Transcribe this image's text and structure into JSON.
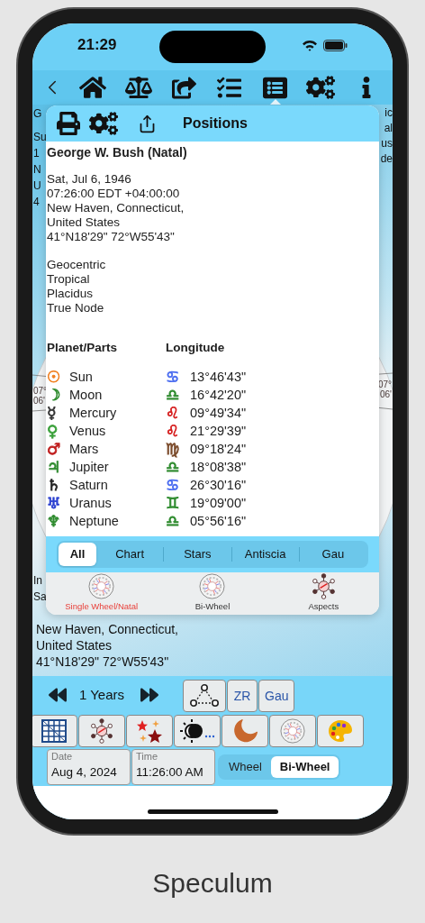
{
  "status_bar": {
    "time": "21:29"
  },
  "toolbar": {
    "tools": [
      {
        "kind": "home",
        "selected": false
      },
      {
        "kind": "scales",
        "selected": false
      },
      {
        "kind": "share",
        "selected": false
      },
      {
        "kind": "checklist",
        "selected": false
      },
      {
        "kind": "list",
        "selected": true
      },
      {
        "kind": "gears",
        "selected": false
      },
      {
        "kind": "info",
        "selected": false
      }
    ]
  },
  "background": {
    "left_fragments": [
      "G",
      "Su",
      "1",
      "N",
      "U",
      "4"
    ],
    "right_fragments": [
      "ic",
      "al",
      "us",
      "de"
    ],
    "wheel_labels": [
      {
        "degree": "07°",
        "minute": "06'"
      },
      {
        "degree": "07°",
        "minute": "06'"
      }
    ],
    "cut_lines": [
      "In",
      "Sa"
    ],
    "lines": [
      "New Haven, Connecticut,",
      "United States",
      "41°N18'29\" 72°W55'43\""
    ]
  },
  "popup": {
    "title": "Positions",
    "chart_name": "George W. Bush (Natal)",
    "details": [
      "Sat, Jul 6, 1946",
      "07:26:00 EDT +04:00:00",
      "New Haven, Connecticut,",
      "United States",
      "41°N18'29\" 72°W55'43\""
    ],
    "settings": [
      "Geocentric",
      "Tropical",
      "Placidus",
      "True Node"
    ],
    "columns": [
      "Planet/Parts",
      "Longitude"
    ],
    "rows": [
      {
        "symbol": "☉",
        "color": "#f07f1f",
        "name": "Sun",
        "sign": {
          "symbol": "♋",
          "color": "#4a6cf0"
        },
        "longitude": "13°46'43\""
      },
      {
        "symbol": "☽",
        "color": "#2e8b2e",
        "name": "Moon",
        "sign": {
          "symbol": "♎",
          "color": "#2e8b2e"
        },
        "longitude": "16°42'20\""
      },
      {
        "symbol": "☿",
        "color": "#333333",
        "name": "Mercury",
        "sign": {
          "symbol": "♌",
          "color": "#d62020"
        },
        "longitude": "09°49'34\""
      },
      {
        "symbol": "♀",
        "color": "#3aa03a",
        "name": "Venus",
        "sign": {
          "symbol": "♌",
          "color": "#d62020"
        },
        "longitude": "21°29'39\""
      },
      {
        "symbol": "♂",
        "color": "#c02020",
        "name": "Mars",
        "sign": {
          "symbol": "♍",
          "color": "#7a4a2a"
        },
        "longitude": "09°18'24\""
      },
      {
        "symbol": "♃",
        "color": "#2e8b2e",
        "name": "Jupiter",
        "sign": {
          "symbol": "♎",
          "color": "#2e8b2e"
        },
        "longitude": "18°08'38\""
      },
      {
        "symbol": "♄",
        "color": "#222222",
        "name": "Saturn",
        "sign": {
          "symbol": "♋",
          "color": "#4a6cf0"
        },
        "longitude": "26°30'16\""
      },
      {
        "symbol": "♅",
        "color": "#2a3fd0",
        "name": "Uranus",
        "sign": {
          "symbol": "♊",
          "color": "#2e8b2e"
        },
        "longitude": "19°09'00\""
      },
      {
        "symbol": "♆",
        "color": "#2e8b2e",
        "name": "Neptune",
        "sign": {
          "symbol": "♎",
          "color": "#2e8b2e"
        },
        "longitude": "05°56'16\""
      }
    ],
    "segments": [
      {
        "label": "All",
        "selected": true
      },
      {
        "label": "Chart",
        "selected": false
      },
      {
        "label": "Stars",
        "selected": false
      },
      {
        "label": "Antiscia",
        "selected": false
      },
      {
        "label": "Gau",
        "selected": false
      }
    ],
    "views": [
      {
        "kind": "wheel",
        "label": "Single Wheel/Natal",
        "selected": true
      },
      {
        "kind": "wheel",
        "label": "Bi-Wheel",
        "selected": false
      },
      {
        "kind": "aspects",
        "label": "Aspects",
        "selected": false
      }
    ]
  },
  "controls": {
    "step": "1 Years",
    "mode_buttons": [
      {
        "kind": "triangle"
      },
      {
        "kind": "text",
        "label": "ZR"
      },
      {
        "kind": "text",
        "label": "Gau"
      }
    ],
    "tool_buttons": [
      {
        "kind": "grid"
      },
      {
        "kind": "aspects"
      },
      {
        "kind": "stars"
      },
      {
        "kind": "eclipse"
      },
      {
        "kind": "moon"
      },
      {
        "kind": "wheel"
      },
      {
        "kind": "palette"
      }
    ],
    "date": {
      "label": "Date",
      "value": "Aug 4, 2024"
    },
    "time": {
      "label": "Time",
      "value": "11:26:00 AM"
    },
    "chart_toggle": [
      {
        "label": "Wheel",
        "selected": false
      },
      {
        "label": "Bi-Wheel",
        "selected": true
      }
    ]
  },
  "caption": "Speculum"
}
